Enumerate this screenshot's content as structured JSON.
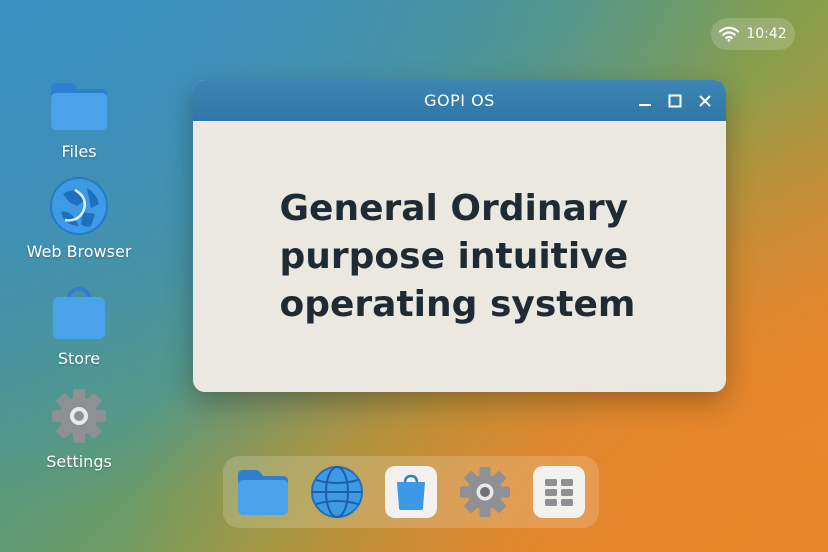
{
  "status": {
    "wifi_icon": "wifi-icon",
    "time": "10:42"
  },
  "desktop": {
    "icons": [
      {
        "label": "Files",
        "icon": "folder-icon"
      },
      {
        "label": "Web Browser",
        "icon": "browser-icon"
      },
      {
        "label": "Store",
        "icon": "shopping-bag-icon"
      },
      {
        "label": "Settings",
        "icon": "gear-icon"
      }
    ]
  },
  "window": {
    "title": "GOPI OS",
    "controls": [
      "minimize-icon",
      "maximize-icon",
      "close-icon"
    ],
    "headline_lines": [
      "General Ordinary",
      "purpose intuitive",
      "operating system"
    ]
  },
  "dock": {
    "items": [
      "folder-icon",
      "globe-icon",
      "shopping-bag-icon",
      "gear-icon",
      "app-grid-icon"
    ]
  },
  "colors": {
    "accent_blue": "#3d85b2",
    "icon_blue": "#4a9fe8",
    "window_bg": "#ebe8e2",
    "headline_text": "#1f2a33",
    "gear_gray": "#8e9094"
  }
}
